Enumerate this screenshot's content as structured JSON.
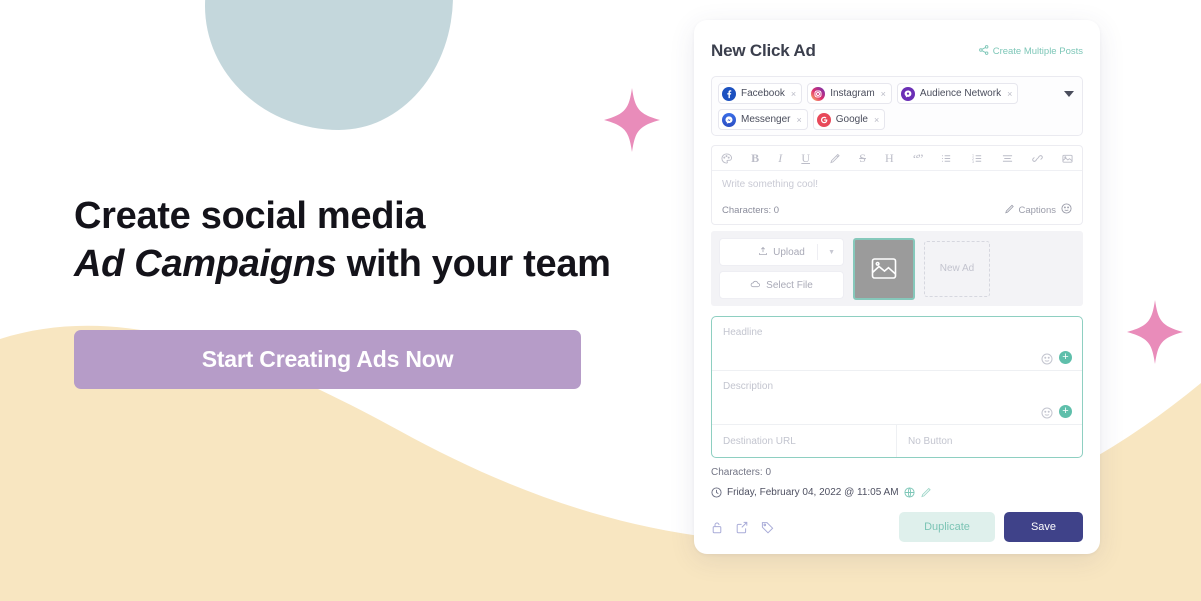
{
  "hero": {
    "line1": "Create social media",
    "line2_em": "Ad Campaigns",
    "line2_rest": " with your team",
    "cta_label": "Start Creating Ads Now"
  },
  "colors": {
    "blob_blue": "#c4d7dc",
    "wave_cream": "#f8e6c1",
    "star_pink": "#e98cba",
    "cta_purple": "#b69cc8",
    "accent_teal": "#7ec7b8",
    "save_navy": "#3f4289"
  },
  "card": {
    "title": "New Click Ad",
    "multi_posts_link": "Create Multiple Posts",
    "platforms": [
      {
        "name": "Facebook",
        "icon": "facebook-icon",
        "remove": "×"
      },
      {
        "name": "Instagram",
        "icon": "instagram-icon",
        "remove": "×"
      },
      {
        "name": "Audience Network",
        "icon": "audience-network-icon",
        "remove": "×"
      },
      {
        "name": "Messenger",
        "icon": "messenger-icon",
        "remove": "×"
      },
      {
        "name": "Google",
        "icon": "google-icon",
        "remove": "×"
      }
    ],
    "toolbar": [
      {
        "icon": "color-palette-icon",
        "glyph": "☺"
      },
      {
        "icon": "bold-icon",
        "glyph": "B"
      },
      {
        "icon": "italic-icon",
        "glyph": "I"
      },
      {
        "icon": "underline-icon",
        "glyph": "U"
      },
      {
        "icon": "highlighter-icon",
        "glyph": "✐"
      },
      {
        "icon": "strikethrough-icon",
        "glyph": "S"
      },
      {
        "icon": "heading-icon",
        "glyph": "H"
      },
      {
        "icon": "quote-icon",
        "glyph": "“”"
      },
      {
        "icon": "bullet-list-icon",
        "glyph": "≡"
      },
      {
        "icon": "numbered-list-icon",
        "glyph": "≣"
      },
      {
        "icon": "align-icon",
        "glyph": "☰"
      },
      {
        "icon": "link-icon",
        "glyph": "⚭"
      },
      {
        "icon": "image-icon",
        "glyph": "▣"
      }
    ],
    "composer": {
      "placeholder": "Write something cool!",
      "characters_label": "Characters: 0",
      "captions_label": "Captions"
    },
    "media": {
      "upload_label": "Upload",
      "select_file_label": "Select File",
      "new_ad_label": "New Ad"
    },
    "preview": {
      "headline_placeholder": "Headline",
      "description_placeholder": "Description",
      "destination_url_placeholder": "Destination URL",
      "button_label": "No Button"
    },
    "footer": {
      "characters_label": "Characters: 0",
      "schedule_text": "Friday, February 04, 2022 @ 11:05 AM",
      "duplicate_label": "Duplicate",
      "save_label": "Save",
      "icons": [
        "lock-icon",
        "external-link-icon",
        "tag-icon"
      ]
    }
  }
}
